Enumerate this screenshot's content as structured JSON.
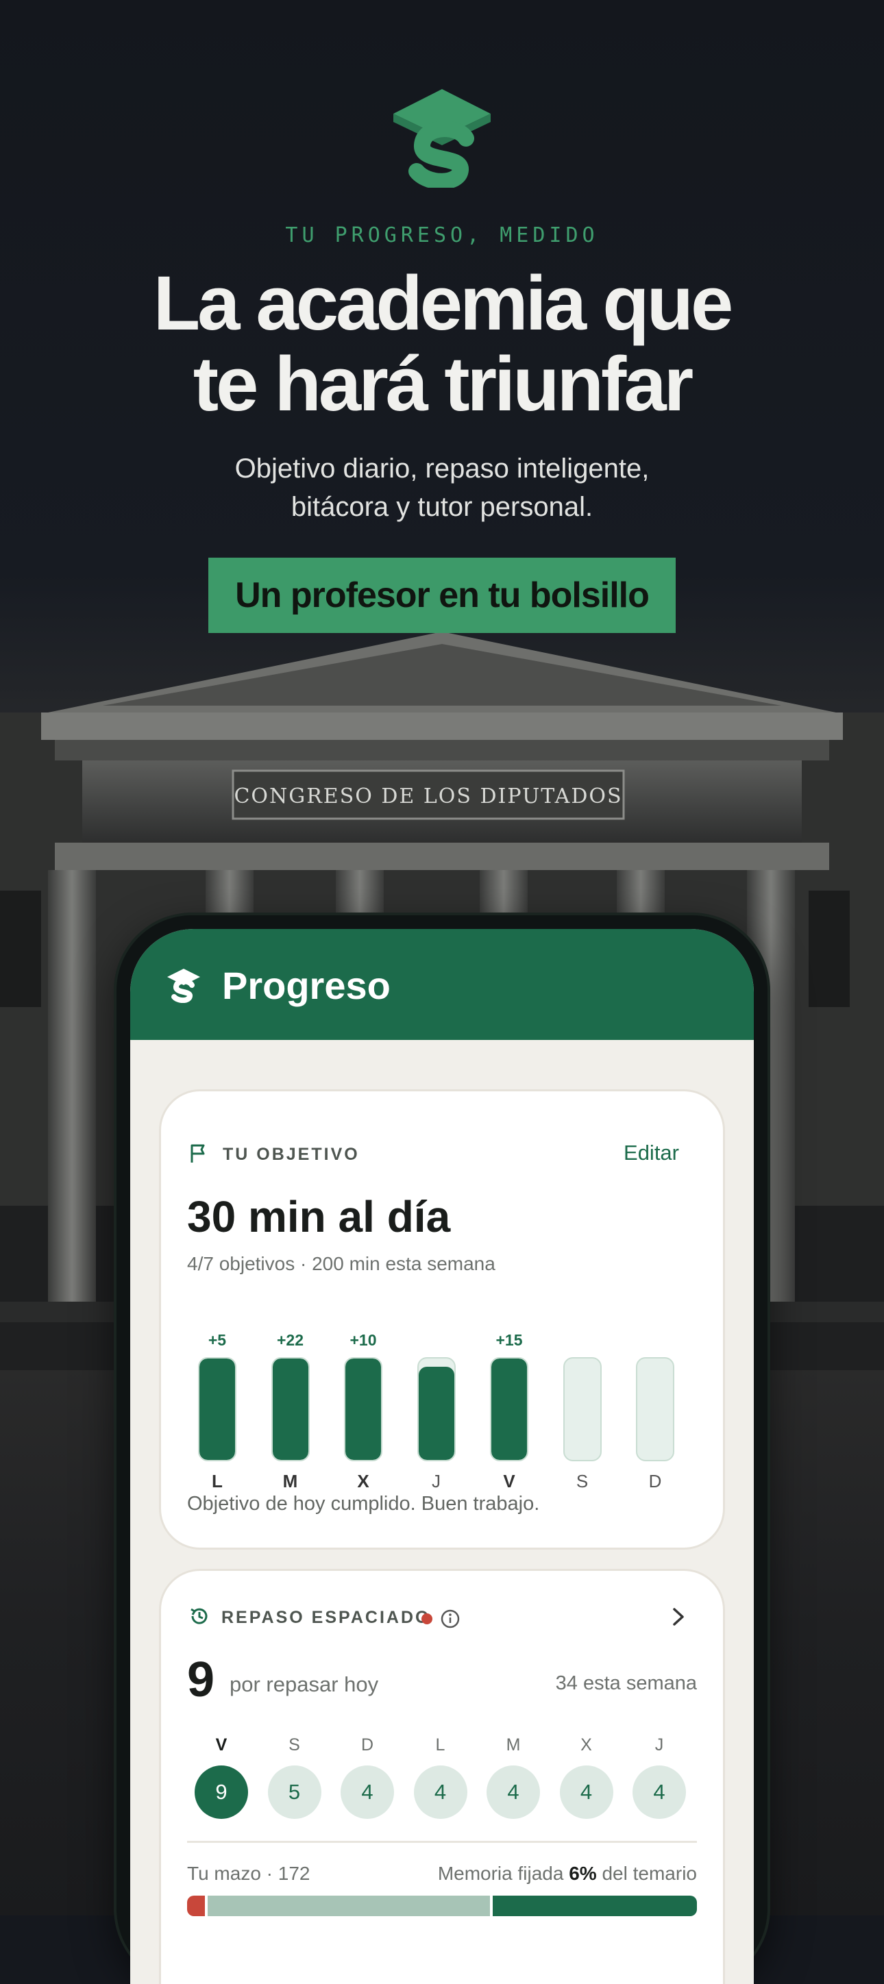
{
  "hero": {
    "eyebrow": "TU PROGRESO, MEDIDO",
    "headline_line1": "La academia que",
    "headline_line2": "te hará triunfar",
    "subtitle_line1": "Objetivo diario, repaso inteligente,",
    "subtitle_line2": "bitácora y tutor personal.",
    "cta": "Un profesor en tu bolsillo",
    "building_inscription": "CONGRESO DE LOS DIPUTADOS"
  },
  "colors": {
    "brand_green": "#1c6b4b",
    "accent_green": "#3d9a69",
    "alert_red": "#c8473a"
  },
  "app": {
    "title": "Progreso",
    "objetivo": {
      "label": "TU OBJETIVO",
      "edit": "Editar",
      "goal": "30 min al día",
      "summary": "4/7 objetivos · 200 min esta semana",
      "days": [
        {
          "day": "L",
          "bonus": "+5",
          "fill": 1.0,
          "bold": true
        },
        {
          "day": "M",
          "bonus": "+22",
          "fill": 1.0,
          "bold": true
        },
        {
          "day": "X",
          "bonus": "+10",
          "fill": 1.0,
          "bold": true
        },
        {
          "day": "J",
          "bonus": "",
          "fill": 0.92,
          "bold": false
        },
        {
          "day": "V",
          "bonus": "+15",
          "fill": 1.0,
          "bold": true
        },
        {
          "day": "S",
          "bonus": "",
          "fill": 0.0,
          "bold": false
        },
        {
          "day": "D",
          "bonus": "",
          "fill": 0.0,
          "bold": false
        }
      ],
      "status": "Objetivo de hoy cumplido. Buen trabajo."
    },
    "repaso": {
      "label": "REPASO ESPACIADO",
      "count": "9",
      "count_label": "por repasar hoy",
      "week": "34 esta semana",
      "schedule": [
        {
          "day": "V",
          "n": "9",
          "active": true
        },
        {
          "day": "S",
          "n": "5",
          "active": false
        },
        {
          "day": "D",
          "n": "4",
          "active": false
        },
        {
          "day": "L",
          "n": "4",
          "active": false
        },
        {
          "day": "M",
          "n": "4",
          "active": false
        },
        {
          "day": "X",
          "n": "4",
          "active": false
        },
        {
          "day": "J",
          "n": "4",
          "active": false
        }
      ],
      "deck": "Tu mazo · 172",
      "memory_prefix": "Memoria fijada",
      "memory_pct": "6%",
      "memory_suffix": "del temario",
      "deck_segments": [
        {
          "share": 0.04,
          "color": "#c8473a"
        },
        {
          "share": 0.56,
          "color": "#a7c4b6"
        },
        {
          "share": 0.4,
          "color": "#1c6b4b"
        }
      ]
    }
  }
}
